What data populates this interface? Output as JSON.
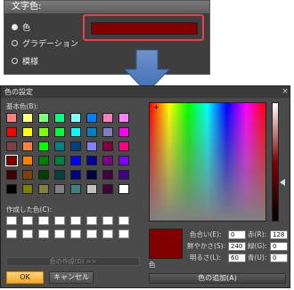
{
  "top_panel": {
    "header": "文字色:",
    "swatch_color": "#800000",
    "options": [
      {
        "label": "色",
        "selected": true
      },
      {
        "label": "グラデーション",
        "selected": false
      },
      {
        "label": "模様",
        "selected": false
      }
    ]
  },
  "dialog": {
    "title": "色の設定",
    "close": "×",
    "basic_colors_label": "基本色(B):",
    "basic_colors": [
      "#ff8080",
      "#ffff80",
      "#80ff80",
      "#00ff80",
      "#80ffff",
      "#0080ff",
      "#ff80c0",
      "#ff80ff",
      "#ff0000",
      "#ffff00",
      "#80ff00",
      "#00ff40",
      "#00ffff",
      "#0080c0",
      "#8080c0",
      "#ff00ff",
      "#804040",
      "#ff8040",
      "#00ff00",
      "#008080",
      "#004080",
      "#8080ff",
      "#800040",
      "#ff0080",
      "#800000",
      "#ff8000",
      "#008000",
      "#008040",
      "#0000ff",
      "#0000a0",
      "#800080",
      "#8000ff",
      "#400000",
      "#804000",
      "#004000",
      "#004040",
      "#000080",
      "#000040",
      "#400040",
      "#400080",
      "#000000",
      "#808000",
      "#808040",
      "#808080",
      "#408080",
      "#c0c0c0",
      "#400040",
      "#ffffff"
    ],
    "selected_basic_index": 24,
    "custom_colors_label": "作成した色(C):",
    "define_button": "色の作成(D) >>",
    "ok_button": "OK",
    "cancel_button": "キャンセル",
    "preview_label": "色",
    "current_color": "#800000",
    "fields": {
      "hue_label": "色合い(E):",
      "hue": "0",
      "sat_label": "鮮やかさ(S):",
      "sat": "240",
      "lum_label": "明るさ(L):",
      "lum": "60",
      "red_label": "赤(R):",
      "red": "128",
      "green_label": "緑(G):",
      "green": "0",
      "blue_label": "青(U):",
      "blue": "0"
    },
    "add_button": "色の追加(A)"
  }
}
